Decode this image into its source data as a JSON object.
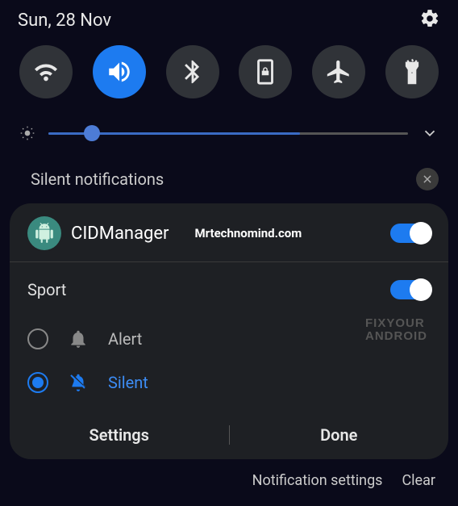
{
  "header": {
    "date": "Sun, 28 Nov"
  },
  "quick_settings": [
    {
      "name": "wifi",
      "active": false
    },
    {
      "name": "sound",
      "active": true
    },
    {
      "name": "bluetooth",
      "active": false
    },
    {
      "name": "rotation-lock",
      "active": false
    },
    {
      "name": "airplane",
      "active": false
    },
    {
      "name": "flashlight",
      "active": false
    }
  ],
  "brightness": {
    "percent": 12,
    "fill_percent": 70
  },
  "section": {
    "title": "Silent notifications"
  },
  "notification": {
    "app_name": "CIDManager",
    "watermark": "Mrtechnomind.com",
    "app_enabled": true,
    "channel": {
      "name": "Sport",
      "enabled": true
    },
    "options": [
      {
        "key": "alert",
        "label": "Alert",
        "selected": false
      },
      {
        "key": "silent",
        "label": "Silent",
        "selected": true
      }
    ],
    "watermark2_l1": "FIXYOUR",
    "watermark2_l2": "ANDROID",
    "actions": {
      "settings": "Settings",
      "done": "Done"
    }
  },
  "footer": {
    "notification_settings": "Notification settings",
    "clear": "Clear"
  }
}
